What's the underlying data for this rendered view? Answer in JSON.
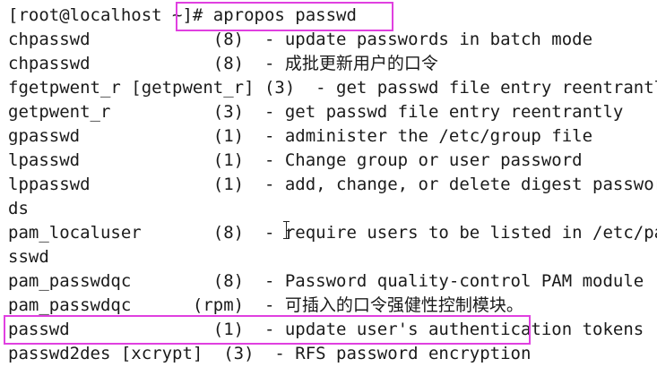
{
  "terminal": {
    "prompt": "[root@localhost ~]# apropos passwd",
    "lines": [
      "chpasswd            (8)  - update passwords in batch mode",
      "chpasswd            (8)  - 成批更新用户的口令",
      "fgetpwent_r [getpwent_r] (3)  - get passwd file entry reentrantly",
      "getpwent_r          (3)  - get passwd file entry reentrantly",
      "gpasswd             (1)  - administer the /etc/group file",
      "lpasswd             (1)  - Change group or user password",
      "lppasswd            (1)  - add, change, or delete digest passwor",
      "ds",
      "pam_localuser       (8)  - require users to be listed in /etc/pa",
      "sswd",
      "pam_passwdqc        (8)  - Password quality-control PAM module",
      "pam_passwdqc      (rpm)  - 可插入的口令强健性控制模块。",
      "passwd              (1)  - update user's authentication tokens",
      "passwd2des [xcrypt]  (3)  - RFS password encryption"
    ]
  },
  "highlight_color": "#e040e0",
  "icons": {
    "cursor": "i-beam-cursor-icon"
  }
}
